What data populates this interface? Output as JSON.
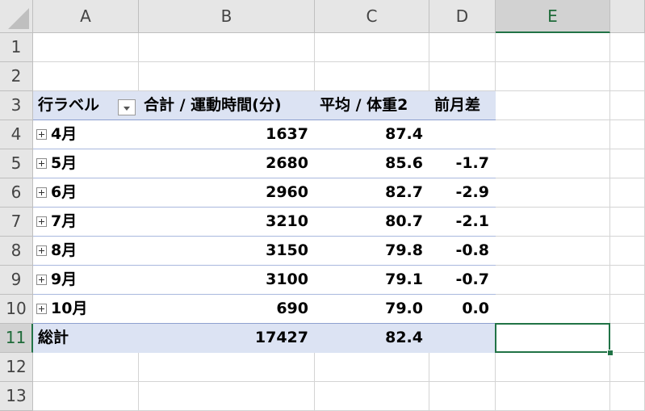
{
  "columns": [
    "A",
    "B",
    "C",
    "D",
    "E"
  ],
  "rows": [
    "1",
    "2",
    "3",
    "4",
    "5",
    "6",
    "7",
    "8",
    "9",
    "10",
    "11",
    "12",
    "13"
  ],
  "selected_cell": {
    "column": "E",
    "row": "11"
  },
  "pivot": {
    "headers": {
      "row_label": "行ラベル",
      "sum_label": "合計 / 運動時間(分)",
      "avg_label": "平均 / 体重2",
      "diff_label": "前月差"
    },
    "data": [
      {
        "month": "4月",
        "sum": "1637",
        "avg": "87.4",
        "diff": ""
      },
      {
        "month": "5月",
        "sum": "2680",
        "avg": "85.6",
        "diff": "-1.7"
      },
      {
        "month": "6月",
        "sum": "2960",
        "avg": "82.7",
        "diff": "-2.9"
      },
      {
        "month": "7月",
        "sum": "3210",
        "avg": "80.7",
        "diff": "-2.1"
      },
      {
        "month": "8月",
        "sum": "3150",
        "avg": "79.8",
        "diff": "-0.8"
      },
      {
        "month": "9月",
        "sum": "3100",
        "avg": "79.1",
        "diff": "-0.7"
      },
      {
        "month": "10月",
        "sum": "690",
        "avg": "79.0",
        "diff": "0.0"
      }
    ],
    "total": {
      "label": "総計",
      "sum": "17427",
      "avg": "82.4",
      "diff": ""
    }
  },
  "colors": {
    "header_bg": "#e6e6e6",
    "pivot_header_bg": "#dce3f3",
    "selection": "#217346"
  }
}
